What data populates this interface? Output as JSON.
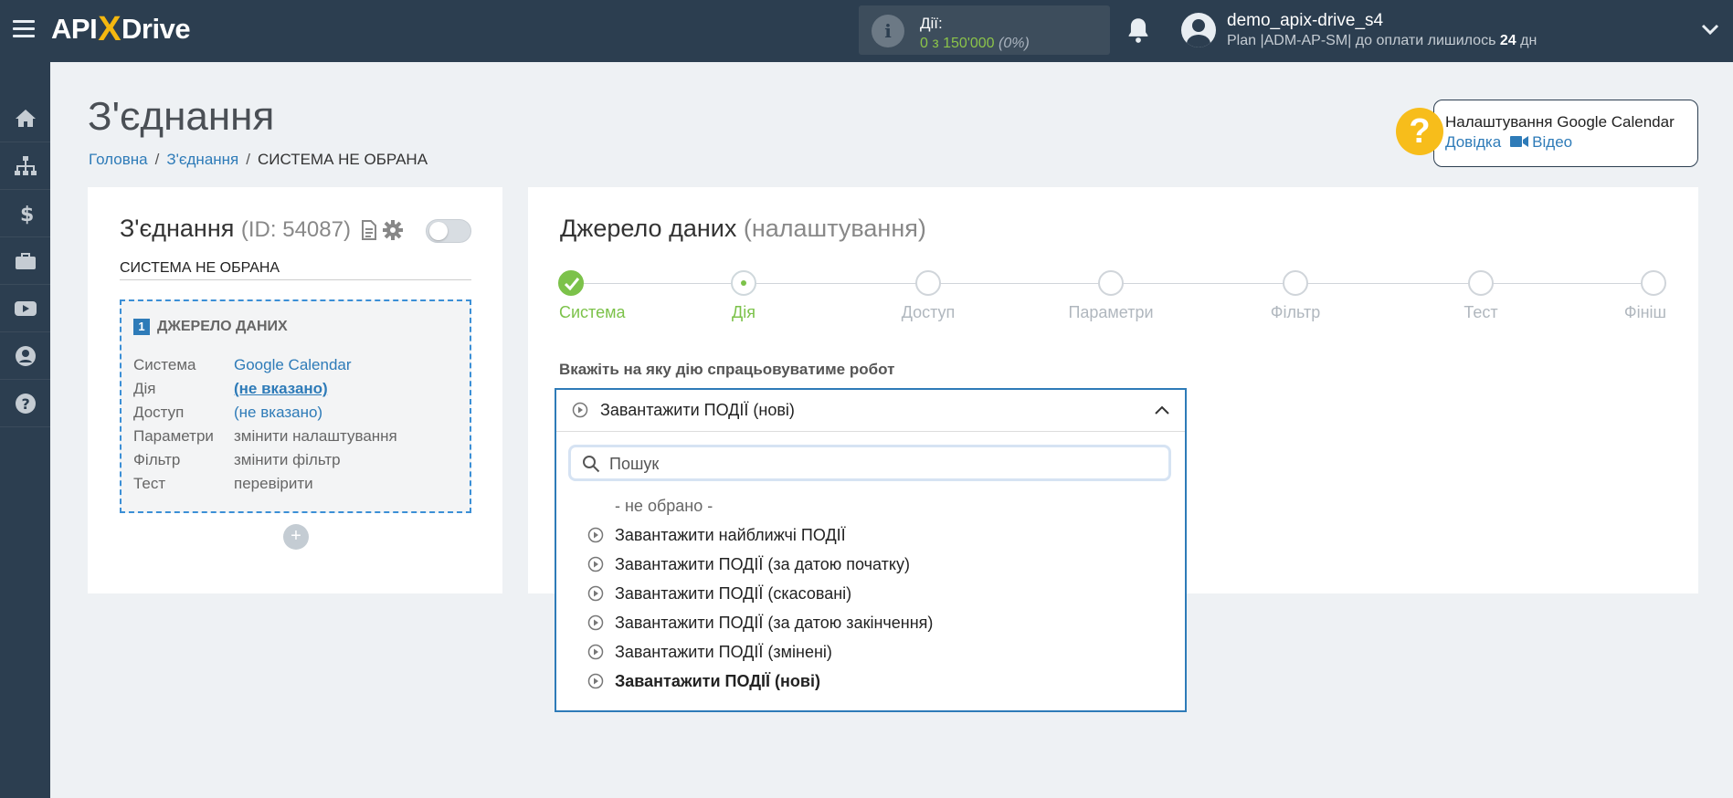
{
  "topbar": {
    "logo_left": "API",
    "logo_x": "X",
    "logo_right": "Drive",
    "actions_label": "Дії:",
    "actions_count": "0 з 150'000",
    "actions_percent": "(0%)",
    "username": "demo_apix-drive_s4",
    "plan_prefix": "Plan |ADM-AP-SM| до оплати лишилось ",
    "plan_days": "24",
    "plan_suffix": " дн"
  },
  "sidebar": {
    "items": [
      "home-icon",
      "sitemap-icon",
      "dollar-icon",
      "briefcase-icon",
      "youtube-icon",
      "user-icon",
      "help-icon"
    ]
  },
  "header": {
    "title": "З'єднання",
    "breadcrumb": [
      "Головна",
      "З'єднання",
      "СИСТЕМА НЕ ОБРАНА"
    ]
  },
  "help": {
    "q": "?",
    "title": "Налаштування Google Calendar",
    "docs_link": "Довідка",
    "video_link": "Відео"
  },
  "left_card": {
    "title": "З'єднання",
    "id_text": "(ID: 54087)",
    "system_text": "СИСТЕМА НЕ ОБРАНА",
    "source_num": "1",
    "source_title": "ДЖЕРЕЛО ДАНИХ",
    "rows": [
      {
        "label": "Система",
        "value": "Google Calendar"
      },
      {
        "label": "Дія",
        "value": "(не вказано)"
      },
      {
        "label": "Доступ",
        "value": "(не вказано)"
      },
      {
        "label": "Параметри",
        "value": "змінити налаштування"
      },
      {
        "label": "Фільтр",
        "value": "змінити фільтр"
      },
      {
        "label": "Тест",
        "value": "перевірити"
      }
    ],
    "add_label": "+"
  },
  "right_card": {
    "title": "Джерело даних",
    "title_sub": "(налаштування)",
    "steps": [
      "Система",
      "Дія",
      "Доступ",
      "Параметри",
      "Фільтр",
      "Тест",
      "Фініш"
    ],
    "action_prompt": "Вкажіть на яку дію спрацьовуватиме робот"
  },
  "select": {
    "value": "Завантажити ПОДІЇ (нові)",
    "search_placeholder": "Пошук",
    "options": [
      "- не обрано -",
      "Завантажити найближчі ПОДІЇ",
      "Завантажити ПОДІЇ (за датою початку)",
      "Завантажити ПОДІЇ (скасовані)",
      "Завантажити ПОДІЇ (за датою закінчення)",
      "Завантажити ПОДІЇ (змінені)",
      "Завантажити ПОДІЇ (нові)"
    ]
  },
  "colors": {
    "nav_bg": "#2c3e50",
    "accent_blue": "#2e7bb8",
    "accent_green": "#7cc24a",
    "help_yellow": "#f7bd1b"
  }
}
